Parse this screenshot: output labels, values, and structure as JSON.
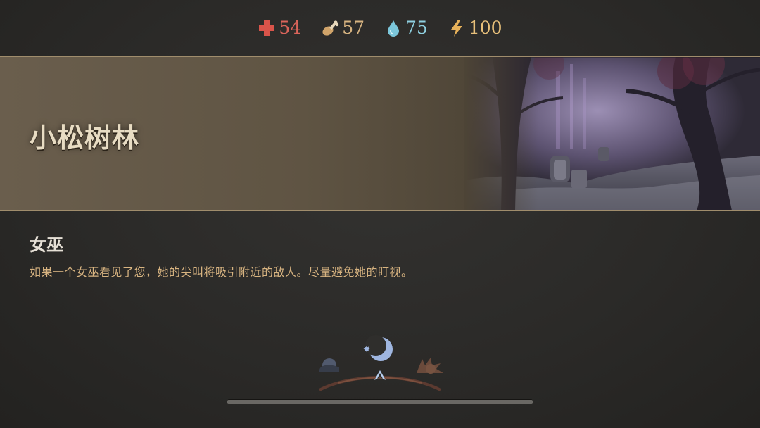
{
  "stats": {
    "health": {
      "icon": "red-cross-icon",
      "value": "54",
      "color": "#d9645a"
    },
    "food": {
      "icon": "meat-leg-icon",
      "value": "57",
      "color": "#d8b481"
    },
    "water": {
      "icon": "water-drop-icon",
      "value": "75",
      "color": "#8fd0e0"
    },
    "energy": {
      "icon": "lightning-bolt-icon",
      "value": "100",
      "color": "#e8c07a"
    }
  },
  "location": {
    "title": "小松树林",
    "image": "haunted-forest-graveyard-illustration"
  },
  "enemy": {
    "name": "女巫",
    "description": "如果一个女巫看见了您，她的尖叫将吸引附近的敌人。尽量避免她的盯视。"
  },
  "day_cycle": {
    "icons": [
      "night-cloud-icon",
      "crescent-moon-icon",
      "sun-icon"
    ],
    "marker": "up-arrow-marker-icon"
  },
  "progress": {
    "fraction": 1.0
  }
}
